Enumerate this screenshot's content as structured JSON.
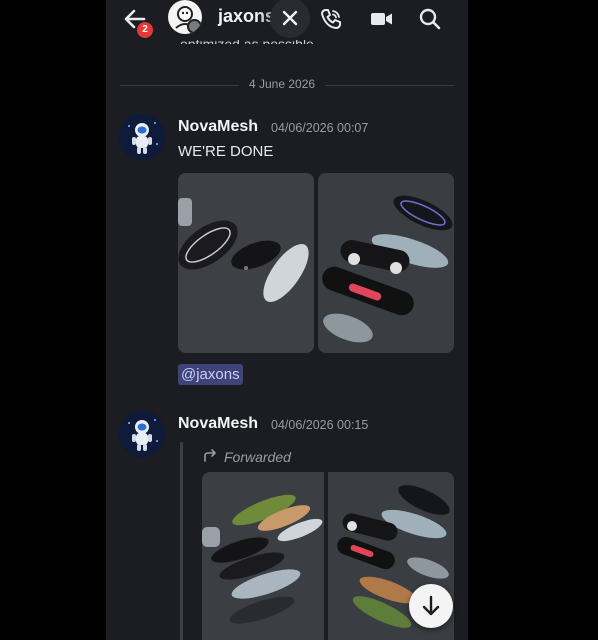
{
  "header": {
    "channel_name": "jaxons",
    "notification_count": "2",
    "icons": [
      "back-arrow-icon",
      "close-icon",
      "phone-call-icon",
      "video-camera-icon",
      "search-icon"
    ]
  },
  "chat": {
    "partial_message": "optimized as possible",
    "date_divider": "4 June 2026",
    "messages": [
      {
        "author": "NovaMesh",
        "timestamp": "04/06/2026 00:07",
        "text": "WE'RE DONE",
        "mention": "@jaxons"
      },
      {
        "author": "NovaMesh",
        "timestamp": "04/06/2026 00:15",
        "forwarded_label": "Forwarded"
      }
    ]
  },
  "colors": {
    "background": "#1c1d22",
    "mention_bg": "#3f4478",
    "mention_text": "#c9cdfb",
    "badge": "#e53935"
  }
}
